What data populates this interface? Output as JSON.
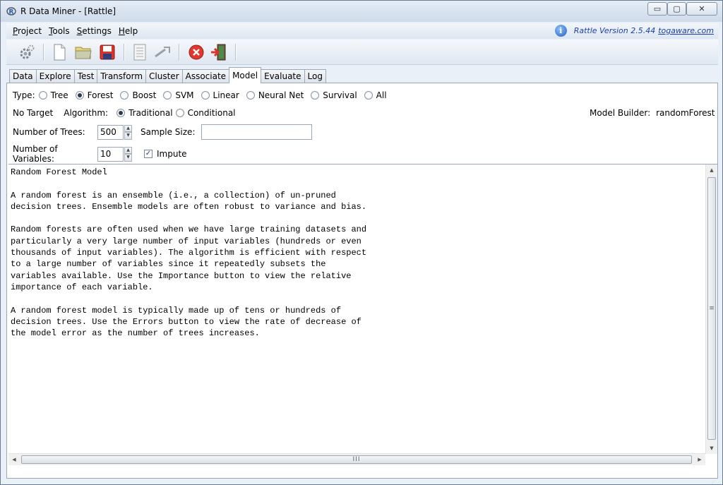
{
  "window": {
    "title": "R Data Miner - [Rattle]",
    "controls": {
      "minimize": "▭",
      "maximize": "▢",
      "close": "✕"
    }
  },
  "menu": {
    "items": [
      "Project",
      "Tools",
      "Settings",
      "Help"
    ],
    "version_text": "Rattle Version 2.5.44",
    "version_link": "togaware.com",
    "info_icon": "i"
  },
  "toolbar": {
    "buttons": [
      "execute-icon",
      "new-icon",
      "open-icon",
      "save-icon",
      "report-icon",
      "export-icon",
      "stop-icon",
      "quit-icon"
    ]
  },
  "tabs": {
    "items": [
      "Data",
      "Explore",
      "Test",
      "Transform",
      "Cluster",
      "Associate",
      "Model",
      "Evaluate",
      "Log"
    ],
    "active": "Model"
  },
  "model": {
    "type_label": "Type:",
    "types": [
      "Tree",
      "Forest",
      "Boost",
      "SVM",
      "Linear",
      "Neural Net",
      "Survival",
      "All"
    ],
    "selected_type": "Forest",
    "target_label": "No Target",
    "algorithm_label": "Algorithm:",
    "algorithms": [
      "Traditional",
      "Conditional"
    ],
    "selected_algorithm": "Traditional",
    "builder_label": "Model Builder:",
    "builder_value": "randomForest",
    "trees_label": "Number of Trees:",
    "trees_value": "500",
    "sample_label": "Sample Size:",
    "sample_value": "",
    "vars_label": "Number of Variables:",
    "vars_value": "10",
    "impute_label": "Impute",
    "impute_checked": true
  },
  "textview": {
    "lines": [
      "Random Forest Model",
      "",
      "A random forest is an ensemble (i.e., a collection) of un-pruned",
      "decision trees. Ensemble models are often robust to variance and bias.",
      "",
      "Random forests are often used when we have large training datasets and",
      "particularly a very large number of input variables (hundreds or even",
      "thousands of input variables). The algorithm is efficient with respect",
      "to a large number of variables since it repeatedly subsets the",
      "variables available. Use the Importance button to view the relative",
      "importance of each variable.",
      "",
      "A random forest model is typically made up of tens or hundreds of",
      "decision trees. Use the Errors button to view the rate of decrease of",
      "the model error as the number of trees increases."
    ]
  },
  "colors": {
    "window_bg": "#eaf0f7",
    "link": "#1a3fb0",
    "stop": "#e0382e"
  }
}
